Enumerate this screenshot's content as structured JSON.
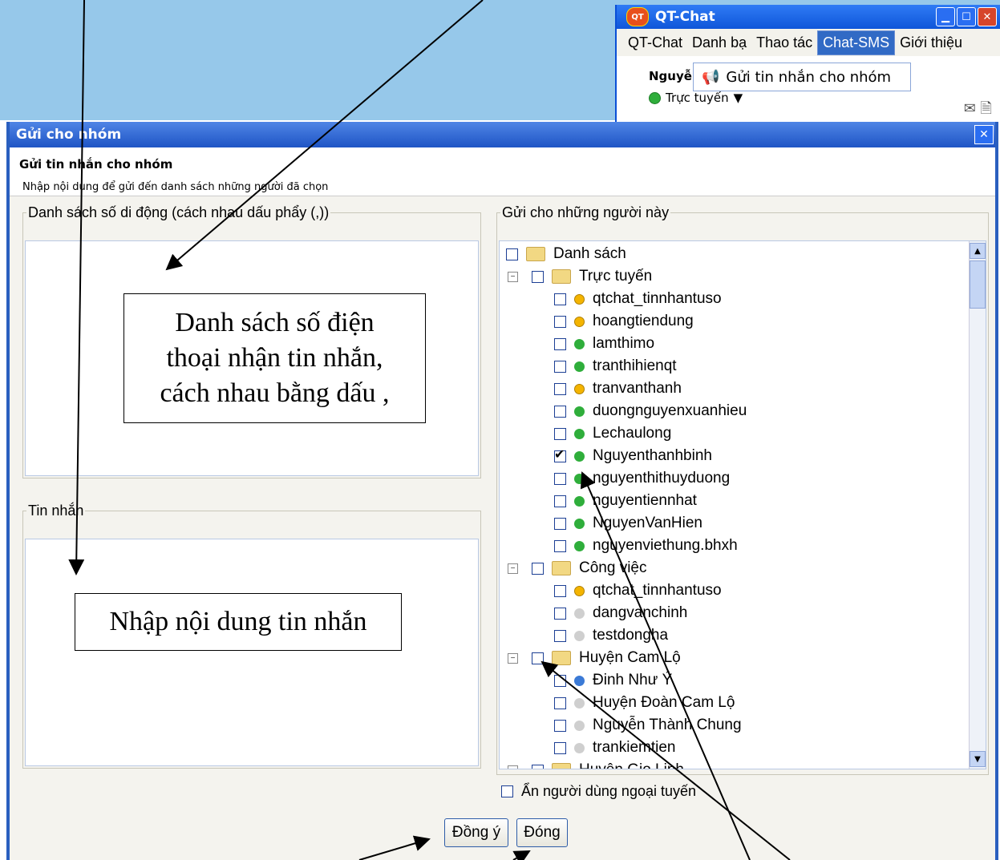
{
  "qtchat": {
    "title": "QT-Chat",
    "logo": "QT",
    "menu": [
      "QT-Chat",
      "Danh bạ",
      "Thao tác",
      "Chat-SMS",
      "Giới thiệu"
    ],
    "user_name": "Nguyễn",
    "status": "Trực tuyến",
    "dropdown_item": "Gửi tin nhắn cho nhóm"
  },
  "dialog": {
    "title": "Gửi cho nhóm",
    "heading": "Gửi tin nhắn cho nhóm",
    "subheading": "Nhập nội dung để gửi đến danh sách những người đã chọn",
    "phone_legend": "Danh sách số di động (cách nhau dấu phẩy (,))",
    "message_legend": "Tin nhắn",
    "tree_legend": "Gửi cho những người này",
    "hide_offline_label": "Ẩn người dùng ngoại tuyến",
    "ok_label": "Đồng ý",
    "close_label": "Đóng"
  },
  "tree": [
    {
      "label": "Danh sách",
      "type": "folder",
      "level": 0,
      "checked": false
    },
    {
      "label": "Trực tuyến",
      "type": "folder",
      "level": 1,
      "checked": false
    },
    {
      "label": "qtchat_tinnhantuso",
      "type": "user",
      "status": "away",
      "level": 2,
      "checked": false
    },
    {
      "label": "hoangtiendung",
      "type": "user",
      "status": "away",
      "level": 2,
      "checked": false
    },
    {
      "label": "lamthimo",
      "type": "user",
      "status": "online",
      "level": 2,
      "checked": false
    },
    {
      "label": "tranthihienqt",
      "type": "user",
      "status": "online",
      "level": 2,
      "checked": false
    },
    {
      "label": "tranvanthanh",
      "type": "user",
      "status": "away",
      "level": 2,
      "checked": false
    },
    {
      "label": "duongnguyenxuanhieu",
      "type": "user",
      "status": "online",
      "level": 2,
      "checked": false
    },
    {
      "label": "Lechaulong",
      "type": "user",
      "status": "online",
      "level": 2,
      "checked": false
    },
    {
      "label": "Nguyenthanhbinh",
      "type": "user",
      "status": "online",
      "level": 2,
      "checked": true
    },
    {
      "label": "nguyenthithuyduong",
      "type": "user",
      "status": "online",
      "level": 2,
      "checked": false
    },
    {
      "label": "nguyentiennhat",
      "type": "user",
      "status": "online",
      "level": 2,
      "checked": false
    },
    {
      "label": "NguyenVanHien",
      "type": "user",
      "status": "online",
      "level": 2,
      "checked": false
    },
    {
      "label": "nguyenviethung.bhxh",
      "type": "user",
      "status": "online",
      "level": 2,
      "checked": false
    },
    {
      "label": "Công việc",
      "type": "folder",
      "level": 1,
      "checked": false
    },
    {
      "label": "qtchat_tinnhantuso",
      "type": "user",
      "status": "away",
      "level": 2,
      "checked": false
    },
    {
      "label": "dangvanchinh",
      "type": "user",
      "status": "offline",
      "level": 2,
      "checked": false
    },
    {
      "label": "testdongha",
      "type": "user",
      "status": "offline",
      "level": 2,
      "checked": false
    },
    {
      "label": "Huyện Cam Lộ",
      "type": "folder",
      "level": 1,
      "checked": false
    },
    {
      "label": "Đinh Như Ý",
      "type": "user",
      "status": "help",
      "level": 2,
      "checked": false
    },
    {
      "label": "Huyện Đoàn Cam Lộ",
      "type": "user",
      "status": "offline",
      "level": 2,
      "checked": false
    },
    {
      "label": "Nguyễn Thành Chung",
      "type": "user",
      "status": "offline",
      "level": 2,
      "checked": false
    },
    {
      "label": "trankiemtien",
      "type": "user",
      "status": "offline",
      "level": 2,
      "checked": false
    },
    {
      "label": "Huyện Gio Linh",
      "type": "folder",
      "level": 1,
      "checked": false
    }
  ],
  "callouts": {
    "phone_lines": [
      "Danh sách số điện",
      "thoại nhận tin nhắn,",
      "cách nhau bằng dấu ,"
    ],
    "message": "Nhập nội dung tin nhắn"
  }
}
